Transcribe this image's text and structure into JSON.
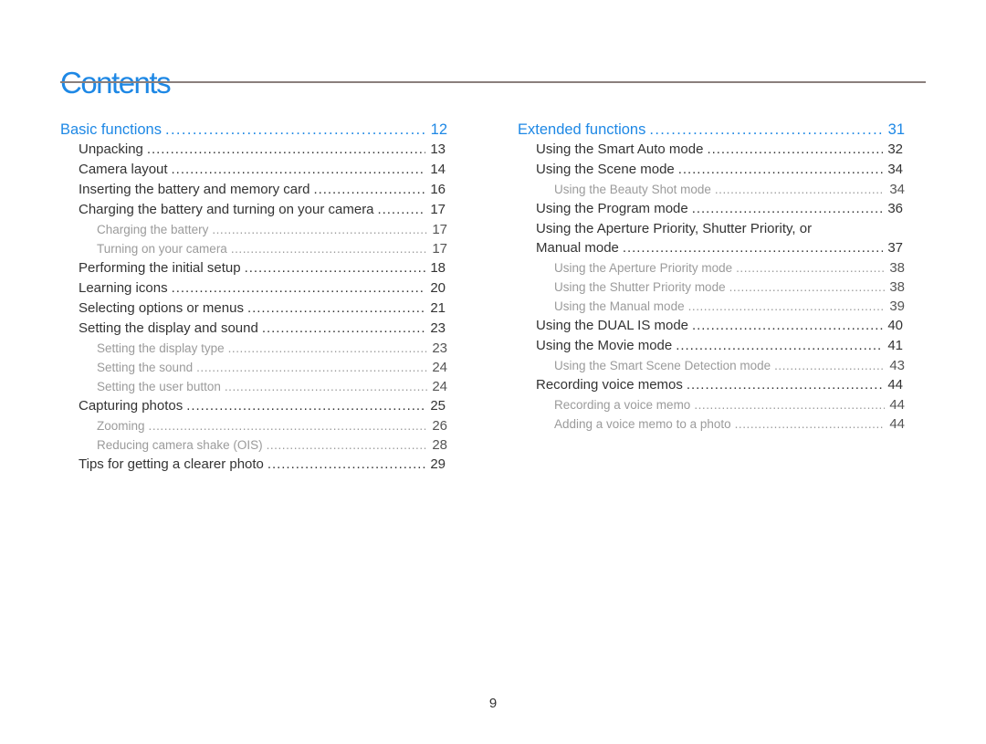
{
  "title": "Contents",
  "page_number": "9",
  "left_column": {
    "section": {
      "label": "Basic functions",
      "page": "12"
    },
    "items": [
      {
        "label": "Unpacking",
        "page": "13",
        "level": 1
      },
      {
        "label": "Camera layout",
        "page": "14",
        "level": 1
      },
      {
        "label": "Inserting the battery and memory card",
        "page": "16",
        "level": 1
      },
      {
        "label": "Charging the battery and turning on your camera",
        "page": "17",
        "level": 1
      },
      {
        "label": "Charging the battery",
        "page": "17",
        "level": 2
      },
      {
        "label": "Turning on your camera",
        "page": "17",
        "level": 2
      },
      {
        "label": "Performing the initial setup",
        "page": "18",
        "level": 1
      },
      {
        "label": "Learning icons",
        "page": "20",
        "level": 1
      },
      {
        "label": "Selecting options or menus",
        "page": "21",
        "level": 1
      },
      {
        "label": "Setting the display and sound",
        "page": "23",
        "level": 1
      },
      {
        "label": "Setting the display type",
        "page": "23",
        "level": 2
      },
      {
        "label": "Setting the sound",
        "page": "24",
        "level": 2
      },
      {
        "label": "Setting the user button",
        "page": "24",
        "level": 2
      },
      {
        "label": "Capturing photos",
        "page": "25",
        "level": 1
      },
      {
        "label": "Zooming",
        "page": "26",
        "level": 2
      },
      {
        "label": "Reducing camera shake (OIS)",
        "page": "28",
        "level": 2
      },
      {
        "label": "Tips for getting a clearer photo",
        "page": "29",
        "level": 1
      }
    ]
  },
  "right_column": {
    "section": {
      "label": "Extended functions",
      "page": "31"
    },
    "items": [
      {
        "label": "Using the Smart Auto mode",
        "page": "32",
        "level": 1
      },
      {
        "label": "Using the Scene mode",
        "page": "34",
        "level": 1
      },
      {
        "label": "Using the Beauty Shot mode",
        "page": "34",
        "level": 2
      },
      {
        "label": "Using the Program mode",
        "page": "36",
        "level": 1
      },
      {
        "label": "Using the Aperture Priority, Shutter Priority, or",
        "label_cont": "Manual mode",
        "page": "37",
        "level": 1
      },
      {
        "label": "Using the Aperture Priority mode",
        "page": "38",
        "level": 2
      },
      {
        "label": "Using the Shutter Priority mode",
        "page": "38",
        "level": 2
      },
      {
        "label": "Using the Manual mode",
        "page": "39",
        "level": 2
      },
      {
        "label": "Using the DUAL IS mode",
        "page": "40",
        "level": 1
      },
      {
        "label": "Using the Movie mode",
        "page": "41",
        "level": 1
      },
      {
        "label": "Using the Smart Scene Detection mode",
        "page": "43",
        "level": 2
      },
      {
        "label": "Recording voice memos",
        "page": "44",
        "level": 1
      },
      {
        "label": "Recording a voice memo",
        "page": "44",
        "level": 2
      },
      {
        "label": "Adding a voice memo to a photo",
        "page": "44",
        "level": 2
      }
    ]
  },
  "colors": {
    "accent": "#1e88e5",
    "rule": "#8a7f7c",
    "text": "#333333",
    "subtext": "#9b9b9b"
  }
}
